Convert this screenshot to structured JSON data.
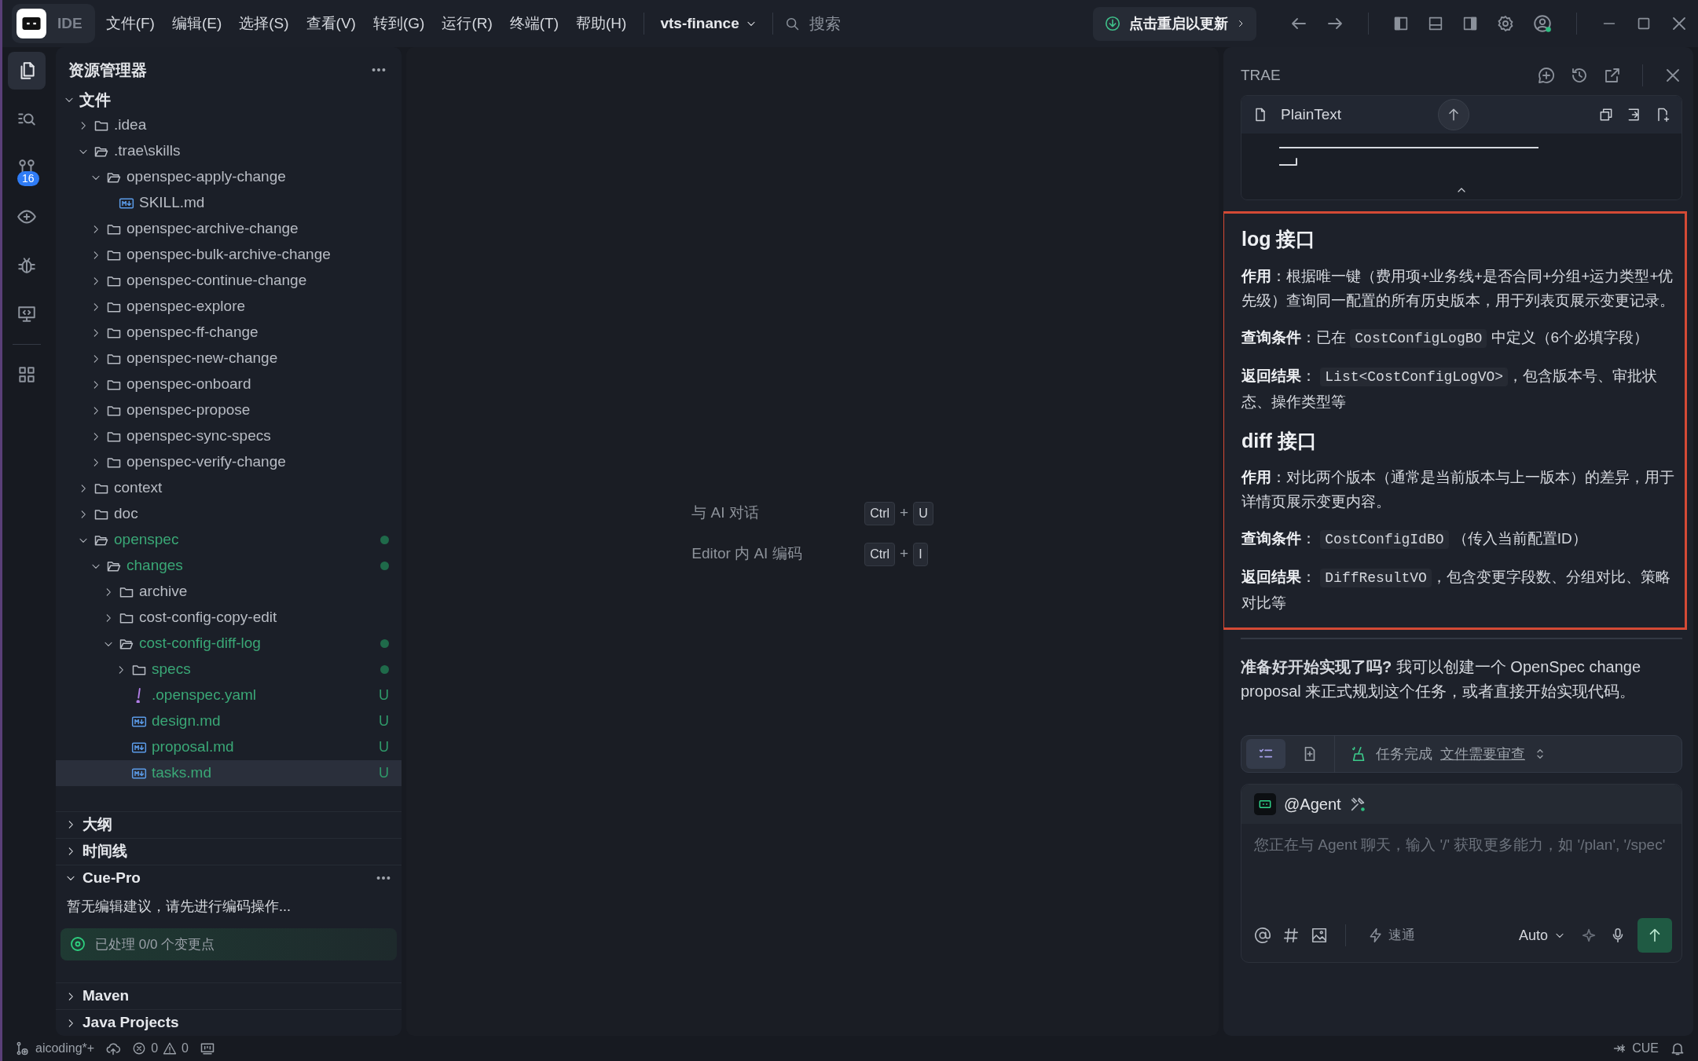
{
  "title_bar": {
    "logo_label": "IDE",
    "menu": [
      "文件(F)",
      "编辑(E)",
      "选择(S)",
      "查看(V)",
      "转到(G)",
      "运行(R)",
      "终端(T)",
      "帮助(H)"
    ],
    "project": "vts-finance",
    "search_placeholder": "搜索",
    "update_button": "点击重启以更新"
  },
  "activity_bar": [
    {
      "kind": "explorer",
      "selected": true
    },
    {
      "kind": "search",
      "selected": false
    },
    {
      "kind": "source_control",
      "selected": false,
      "badge": "16"
    },
    {
      "kind": "preview",
      "selected": false
    },
    {
      "kind": "debug",
      "selected": false
    },
    {
      "kind": "remote",
      "selected": false
    },
    {
      "kind": "extensions",
      "selected": false
    }
  ],
  "explorer": {
    "title": "资源管理器",
    "section": "文件",
    "section_expanded": true,
    "tree": [
      {
        "label": ".idea",
        "kind": "folder",
        "expanded": false,
        "selected": false
      },
      {
        "label": ".trae\\skills",
        "kind": "folder",
        "expanded": true,
        "selected": false,
        "children": [
          {
            "label": "openspec-apply-change",
            "kind": "folder",
            "expanded": true,
            "selected": false,
            "children": [
              {
                "label": "SKILL.md",
                "kind": "markdown",
                "selected": false
              }
            ]
          },
          {
            "label": "openspec-archive-change",
            "kind": "folder",
            "expanded": false,
            "selected": false
          },
          {
            "label": "openspec-bulk-archive-change",
            "kind": "folder",
            "expanded": false,
            "selected": false
          },
          {
            "label": "openspec-continue-change",
            "kind": "folder",
            "expanded": false,
            "selected": false
          },
          {
            "label": "openspec-explore",
            "kind": "folder",
            "expanded": false,
            "selected": false
          },
          {
            "label": "openspec-ff-change",
            "kind": "folder",
            "expanded": false,
            "selected": false
          },
          {
            "label": "openspec-new-change",
            "kind": "folder",
            "expanded": false,
            "selected": false
          },
          {
            "label": "openspec-onboard",
            "kind": "folder",
            "expanded": false,
            "selected": false
          },
          {
            "label": "openspec-propose",
            "kind": "folder",
            "expanded": false,
            "selected": false
          },
          {
            "label": "openspec-sync-specs",
            "kind": "folder",
            "expanded": false,
            "selected": false
          },
          {
            "label": "openspec-verify-change",
            "kind": "folder",
            "expanded": false,
            "selected": false
          }
        ]
      },
      {
        "label": "context",
        "kind": "folder",
        "expanded": false,
        "selected": false
      },
      {
        "label": "doc",
        "kind": "folder",
        "expanded": false,
        "selected": false
      },
      {
        "label": "openspec",
        "kind": "folder",
        "expanded": true,
        "selected": false,
        "changed": true,
        "dot": true,
        "children": [
          {
            "label": "changes",
            "kind": "folder",
            "expanded": true,
            "selected": false,
            "changed": true,
            "dot": true,
            "children": [
              {
                "label": "archive",
                "kind": "folder",
                "expanded": false,
                "selected": false
              },
              {
                "label": "cost-config-copy-edit",
                "kind": "folder",
                "expanded": false,
                "selected": false
              },
              {
                "label": "cost-config-diff-log",
                "kind": "folder",
                "expanded": true,
                "selected": false,
                "changed": true,
                "dot": true,
                "children": [
                  {
                    "label": "specs",
                    "kind": "folder",
                    "expanded": false,
                    "selected": false,
                    "changed": true,
                    "dot": true
                  },
                  {
                    "label": ".openspec.yaml",
                    "kind": "yaml",
                    "selected": false,
                    "changed": true,
                    "badge": "U"
                  },
                  {
                    "label": "design.md",
                    "kind": "markdown",
                    "selected": false,
                    "changed": true,
                    "badge": "U"
                  },
                  {
                    "label": "proposal.md",
                    "kind": "markdown",
                    "selected": false,
                    "changed": true,
                    "badge": "U"
                  },
                  {
                    "label": "tasks.md",
                    "kind": "markdown",
                    "selected": true,
                    "changed": true,
                    "badge": "U"
                  }
                ]
              }
            ]
          }
        ]
      }
    ]
  },
  "panels": [
    {
      "title": "大纲",
      "expanded": false
    },
    {
      "title": "时间线",
      "expanded": false
    },
    {
      "title": "Cue-Pro",
      "expanded": true,
      "message": "暂无编辑建议，请先进行编码操作...",
      "status": "已处理 0/0 个变更点"
    },
    {
      "title": "Maven",
      "expanded": false
    },
    {
      "title": "Java Projects",
      "expanded": false
    }
  ],
  "editor": {
    "shortcuts": [
      {
        "label": "与 AI 对话",
        "keys": [
          "Ctrl",
          "U"
        ]
      },
      {
        "label": "Editor 内 AI 编码",
        "keys": [
          "Ctrl",
          "I"
        ]
      }
    ],
    "joiner": "+"
  },
  "chat": {
    "title": "TRAE",
    "code_block": {
      "language": "PlainText"
    },
    "answer": {
      "highlighted": true,
      "blocks": [
        {
          "kind": "heading",
          "text": "log 接口"
        },
        {
          "kind": "paragraph",
          "parts": [
            {
              "kind": "text",
              "text": "**作用**：根据唯一键（费用项+业务线+是否合同+分组+运力类型+优先级）查询同一配置的所有历史版本，用于列表页展示变更记录。"
            }
          ]
        },
        {
          "kind": "paragraph",
          "parts": [
            {
              "kind": "text",
              "text": "**查询条件**：已在 "
            },
            {
              "kind": "code",
              "text": "CostConfigLogBO"
            },
            {
              "kind": "text",
              "text": " 中定义（6个必填字段）"
            }
          ]
        },
        {
          "kind": "paragraph",
          "parts": [
            {
              "kind": "text",
              "text": "**返回结果**： "
            },
            {
              "kind": "code",
              "text": "List<CostConfigLogVO>"
            },
            {
              "kind": "text",
              "text": "，包含版本号、审批状态、操作类型等"
            }
          ]
        },
        {
          "kind": "heading",
          "text": "diff 接口"
        },
        {
          "kind": "paragraph",
          "parts": [
            {
              "kind": "text",
              "text": "**作用**：对比两个版本（通常是当前版本与上一版本）的差异，用于详情页展示变更内容。"
            }
          ]
        },
        {
          "kind": "paragraph",
          "parts": [
            {
              "kind": "text",
              "text": "**查询条件**： "
            },
            {
              "kind": "code",
              "text": "CostConfigIdBO"
            },
            {
              "kind": "text",
              "text": " （传入当前配置ID）"
            }
          ]
        },
        {
          "kind": "paragraph",
          "parts": [
            {
              "kind": "text",
              "text": "**返回结果**： "
            },
            {
              "kind": "code",
              "text": "DiffResultVO"
            },
            {
              "kind": "text",
              "text": "，包含变更字段数、分组对比、策略对比等"
            }
          ]
        }
      ]
    },
    "closing": "**准备好开始实现了吗?** 我可以创建一个 OpenSpec change proposal 来正式规划这个任务，或者直接开始实现代码。",
    "task_bar": {
      "tabs": [
        {
          "kind": "tasks",
          "selected": true
        },
        {
          "kind": "files",
          "selected": false
        }
      ],
      "status": "任务完成",
      "link": "文件需要审查"
    },
    "input": {
      "agent": "@Agent",
      "placeholder": "您正在与 Agent 聊天，输入 '/' 获取更多能力，如 '/plan', '/spec'",
      "mode": "速通",
      "model": "Auto"
    }
  },
  "status_bar": {
    "branch": "aicoding*+",
    "errors": "0",
    "warnings": "0",
    "right_label": "CUE"
  }
}
